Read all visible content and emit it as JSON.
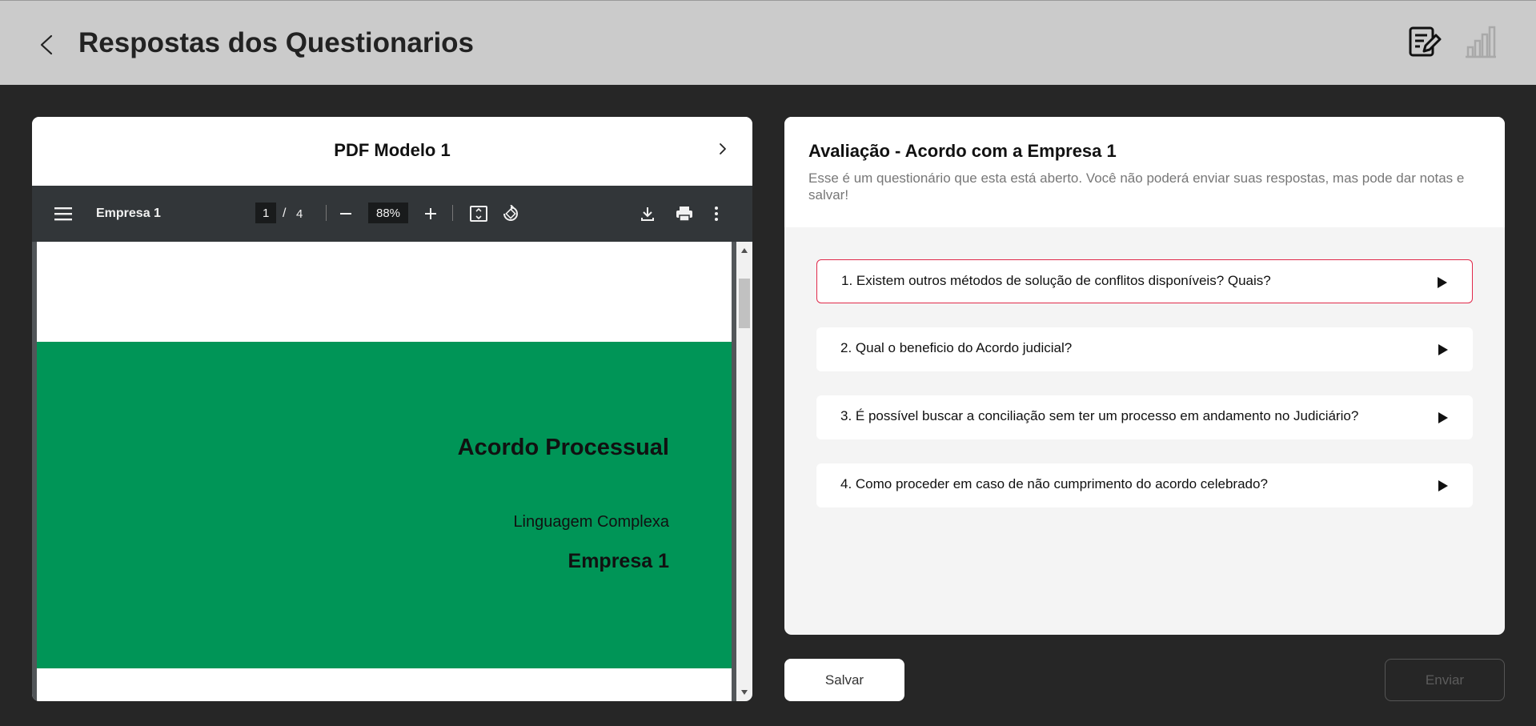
{
  "header": {
    "title": "Respostas dos Questionarios",
    "icons": [
      "back-arrow-icon",
      "edit-notes-icon",
      "bar-chart-icon"
    ]
  },
  "pdf_panel": {
    "title": "PDF Modelo 1",
    "toolbar": {
      "document_name": "Empresa 1",
      "current_page": "1",
      "page_separator": "/",
      "total_pages": "4",
      "zoom": "88%"
    },
    "page": {
      "heading": "Acordo Processual",
      "subtitle": "Linguagem Complexa",
      "company": "Empresa 1"
    }
  },
  "questionnaire": {
    "title": "Avaliação - Acordo com a Empresa 1",
    "description": "Esse é um questionário que esta está aberto. Você não poderá enviar suas respostas, mas pode dar notas e salvar!",
    "questions": [
      {
        "label": "1. Existem outros métodos de solução de conflitos disponíveis? Quais?",
        "active": true
      },
      {
        "label": "2. Qual o beneficio do Acordo judicial?",
        "active": false
      },
      {
        "label": "3. É possível buscar a conciliação sem ter um processo em andamento no Judiciário?",
        "active": false
      },
      {
        "label": "4. Como proceder em caso de não cumprimento do acordo celebrado?",
        "active": false
      }
    ]
  },
  "actions": {
    "save_label": "Salvar",
    "send_label": "Enviar"
  },
  "colors": {
    "header_bg": "#cbcbcb",
    "page_bg": "#262626",
    "pdf_green": "#009557",
    "active_border": "#e0294a"
  }
}
